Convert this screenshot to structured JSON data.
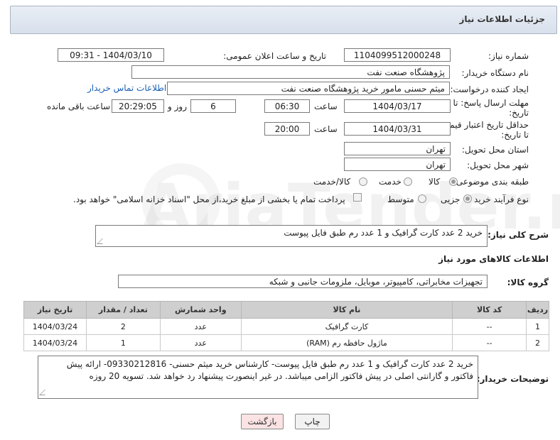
{
  "header": {
    "title": "جزئیات اطلاعات نیاز"
  },
  "watermark": {
    "text": "AriaTender.net"
  },
  "fields": {
    "need_number_label": "شماره نیاز:",
    "need_number": "1104099512000248",
    "announce_label": "تاریخ و ساعت اعلان عمومی:",
    "announce_value": "1404/03/10 - 09:31",
    "buyer_org_label": "نام دستگاه خریدار:",
    "buyer_org": "پژوهشگاه صنعت نفت",
    "creator_label": "ایجاد کننده درخواست:",
    "creator": "میثم حسنی مامور خرید پژوهشگاه صنعت نفت",
    "contact_link": "اطلاعات تماس خریدار",
    "reply_deadline_label_1": "مهلت ارسال پاسخ: تا",
    "reply_deadline_label_2": "تاریخ:",
    "reply_date": "1404/03/17",
    "time_label": "ساعت",
    "reply_time": "06:30",
    "days_value": "6",
    "days_label": "روز و",
    "remaining_value": "20:29:05",
    "remaining_label": "ساعت باقی مانده",
    "price_deadline_label_1": "حداقل تاریخ اعتبار قیمت:",
    "price_deadline_label_2": "تا تاریخ:",
    "price_date": "1404/03/31",
    "price_time": "20:00",
    "province_label": "استان محل تحویل:",
    "province": "تهران",
    "city_label": "شهر محل تحویل:",
    "city": "تهران",
    "category_label": "طبقه بندی موضوعی:",
    "category_options": [
      "کالا",
      "خدمت",
      "کالا/خدمت"
    ],
    "process_label": "نوع فرآیند خرید :",
    "process_options": [
      "جزیی",
      "متوسط"
    ],
    "payment_note": "پرداخت تمام یا بخشی از مبلغ خرید،از محل \"اسناد خزانه اسلامی\" خواهد بود."
  },
  "summary": {
    "label": "شرح کلی نیاز:",
    "value": "خرید 2 عدد کارت گرافیک و 1 عدد رم طبق فایل پیوست"
  },
  "goods": {
    "section_title": "اطلاعات کالاهای مورد نیاز",
    "group_label": "گروه کالا:",
    "group_value": "تجهیزات مخابراتی، کامپیوتر، موبایل، ملزومات جانبی و شبکه"
  },
  "table": {
    "headers": [
      "ردیف",
      "کد کالا",
      "نام کالا",
      "واحد شمارش",
      "تعداد / مقدار",
      "تاریخ نیاز"
    ],
    "rows": [
      [
        "1",
        "--",
        "کارت گرافیک",
        "عدد",
        "2",
        "1404/03/24"
      ],
      [
        "2",
        "--",
        "ماژول حافظه رم (RAM)",
        "عدد",
        "1",
        "1404/03/24"
      ]
    ]
  },
  "buyer_notes": {
    "label": "توضیحات خریدار:",
    "value": "خرید 2 عدد کارت گرافیک و 1 عدد رم طبق فایل پیوست- کارشناس خرید میثم حسنی- 09330212816- ارائه پیش فاکتور و گارانتی اصلی در پیش فاکتور الزامی میباشد. در غیر اینصورت پیشنهاد رد خواهد شد. تسویه 20 روزه"
  },
  "buttons": {
    "print": "چاپ",
    "back": "بازگشت"
  }
}
